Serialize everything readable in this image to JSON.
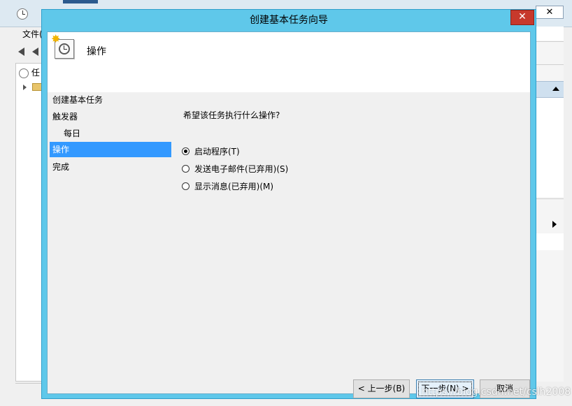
{
  "background_window": {
    "menu": {
      "file_label": "文件("
    },
    "tree": {
      "root_label": "任"
    },
    "close_glyph": "✕"
  },
  "dialog": {
    "title": "创建基本任务向导",
    "close_glyph": "✕",
    "header": {
      "heading": "操作",
      "icon": "task-scheduler-wizard-icon"
    },
    "nav": {
      "items": [
        {
          "label": "创建基本任务",
          "selected": false,
          "indent": false
        },
        {
          "label": "触发器",
          "selected": false,
          "indent": false
        },
        {
          "label": "每日",
          "selected": false,
          "indent": true
        },
        {
          "label": "操作",
          "selected": true,
          "indent": false
        },
        {
          "label": "完成",
          "selected": false,
          "indent": false
        }
      ]
    },
    "content": {
      "question": "希望该任务执行什么操作?",
      "options": [
        {
          "label": "启动程序(T)",
          "checked": true
        },
        {
          "label": "发送电子邮件(已弃用)(S)",
          "checked": false
        },
        {
          "label": "显示消息(已弃用)(M)",
          "checked": false
        }
      ]
    },
    "buttons": {
      "back": "< 上一步(B)",
      "next": "下一步(N) >",
      "cancel": "取消"
    }
  },
  "watermark": "https://blog.csdn.net/cslh2008",
  "colors": {
    "title_bar": "#5fc8ea",
    "selection": "#3399ff",
    "close_button": "#c7392c"
  }
}
